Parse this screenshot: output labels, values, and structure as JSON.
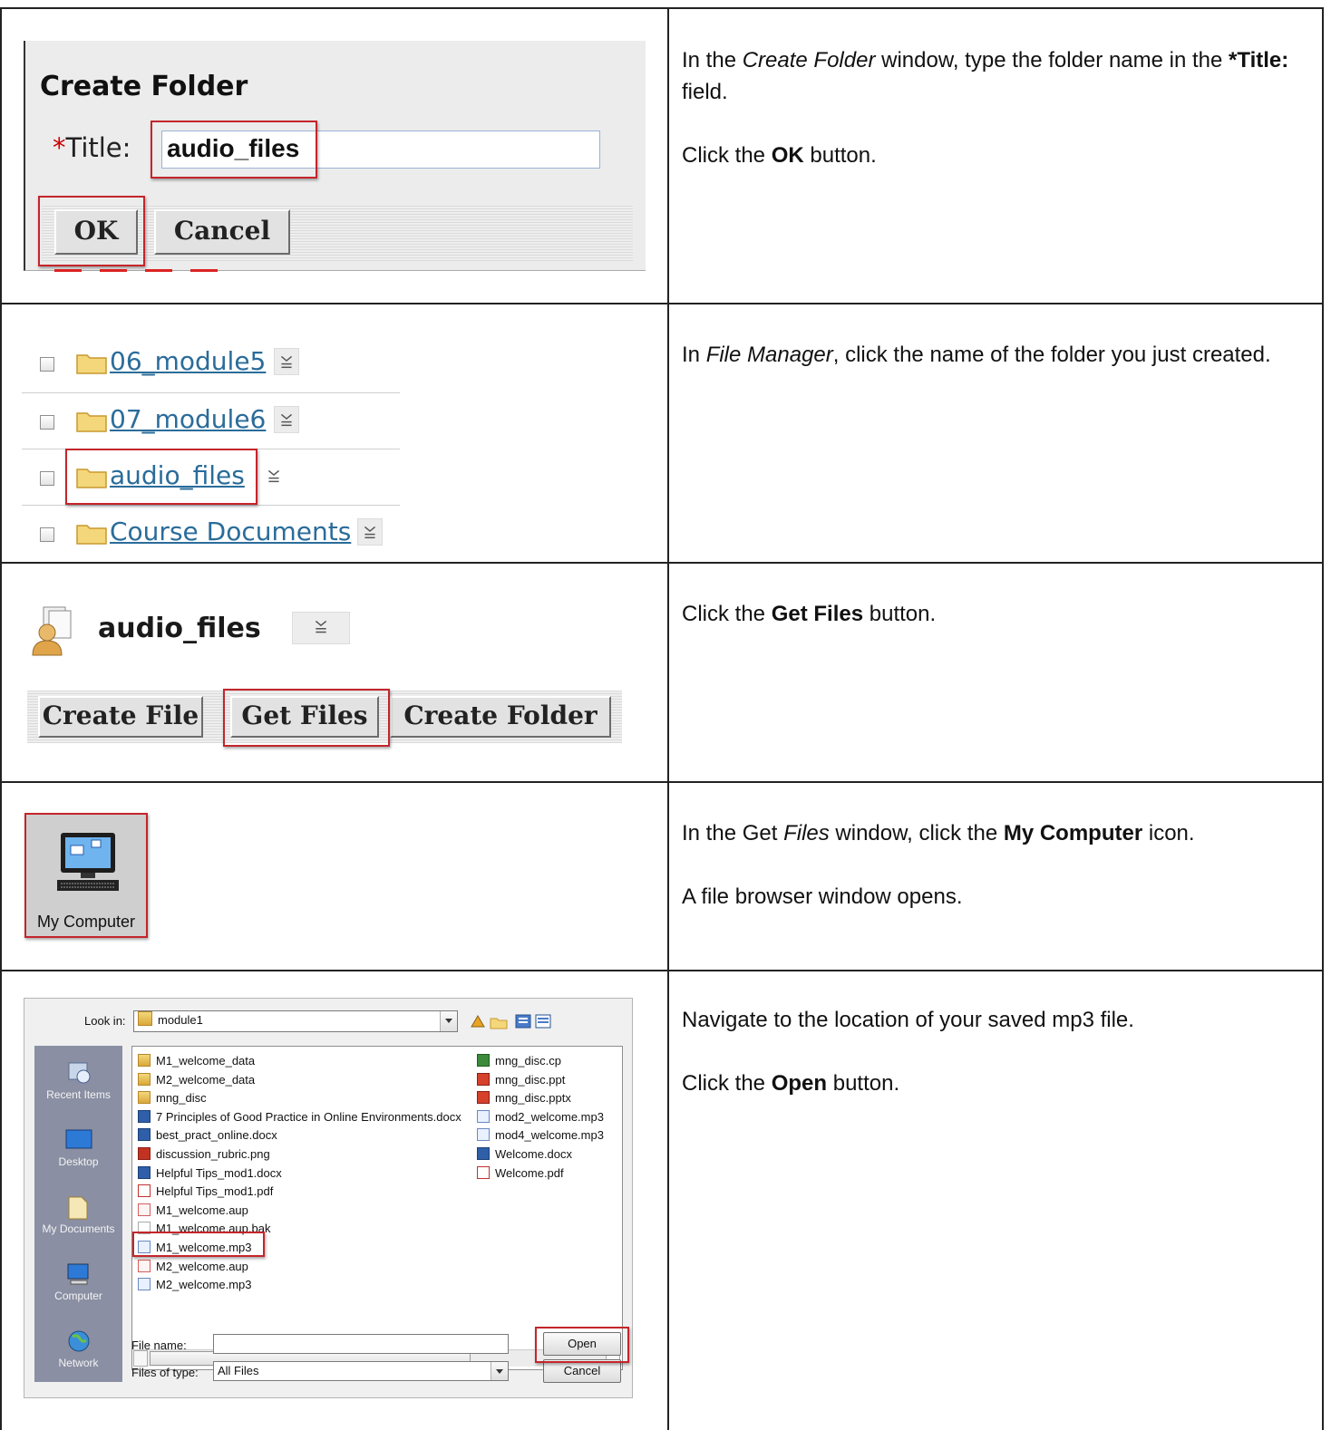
{
  "row1": {
    "dialog_title": "Create Folder",
    "title_required_mark": "*",
    "title_label": "Title:",
    "title_value": "audio_files",
    "ok_label": "OK",
    "cancel_label": "Cancel",
    "desc": {
      "p1_a": "In the ",
      "p1_em": "Create Folder",
      "p1_b": " window, type the folder name in the ",
      "p1_strong": "*Title:",
      "p1_c": " field.",
      "p2_a": "Click the ",
      "p2_strong": "OK",
      "p2_b": " button."
    }
  },
  "row2": {
    "folders": [
      {
        "name": "06_module5"
      },
      {
        "name": "07_module6"
      },
      {
        "name": "audio_files"
      },
      {
        "name": "Course Documents"
      }
    ],
    "desc": {
      "p1_a": "In ",
      "p1_em": "File Manager",
      "p1_b": ", click the name of the folder you just created."
    }
  },
  "row3": {
    "folder_title": "audio_files",
    "create_file_label": "Create File",
    "get_files_label": "Get Files",
    "create_folder_label": "Create Folder",
    "desc": {
      "p1_a": "Click the ",
      "p1_strong": "Get Files",
      "p1_b": " button."
    }
  },
  "row4": {
    "my_computer_label": "My Computer",
    "desc": {
      "p1_a": "In the Get ",
      "p1_em": "Files",
      "p1_b": " window, click the ",
      "p1_strong": "My Computer",
      "p1_c": " icon.",
      "p2": "A file browser window opens."
    }
  },
  "row5": {
    "look_in_label": "Look in:",
    "look_in_value": "module1",
    "sidebar": [
      "Recent Items",
      "Desktop",
      "My Documents",
      "Computer",
      "Network"
    ],
    "files_col1": [
      {
        "name": "M1_welcome_data",
        "icon": "folder"
      },
      {
        "name": "M2_welcome_data",
        "icon": "folder"
      },
      {
        "name": "mng_disc",
        "icon": "folder"
      },
      {
        "name": "7 Principles of Good Practice in Online Environments.docx",
        "icon": "docx"
      },
      {
        "name": "best_pract_online.docx",
        "icon": "docx"
      },
      {
        "name": "discussion_rubric.png",
        "icon": "png"
      },
      {
        "name": "Helpful Tips_mod1.docx",
        "icon": "docx"
      },
      {
        "name": "Helpful Tips_mod1.pdf",
        "icon": "pdf"
      },
      {
        "name": "M1_welcome.aup",
        "icon": "aup"
      },
      {
        "name": "M1_welcome.aup.bak",
        "icon": "blank"
      },
      {
        "name": "M1_welcome.mp3",
        "icon": "mp3"
      },
      {
        "name": "M2_welcome.aup",
        "icon": "aup"
      },
      {
        "name": "M2_welcome.mp3",
        "icon": "mp3"
      }
    ],
    "files_col2": [
      {
        "name": "mng_disc.cp",
        "icon": "cp"
      },
      {
        "name": "mng_disc.ppt",
        "icon": "ppt"
      },
      {
        "name": "mng_disc.pptx",
        "icon": "ppt"
      },
      {
        "name": "mod2_welcome.mp3",
        "icon": "mp3"
      },
      {
        "name": "mod4_welcome.mp3",
        "icon": "mp3"
      },
      {
        "name": "Welcome.docx",
        "icon": "docx"
      },
      {
        "name": "Welcome.pdf",
        "icon": "pdf"
      }
    ],
    "file_name_label": "File name:",
    "file_name_value": "",
    "files_of_type_label": "Files of type:",
    "files_of_type_value": "All Files",
    "open_label": "Open",
    "cancel_label": "Cancel",
    "desc": {
      "p1": "Navigate to the location of your saved mp3 file.",
      "p2_a": "Click the ",
      "p2_strong": "Open",
      "p2_b": " button."
    }
  },
  "colors": {
    "highlight": "#c4252b",
    "link": "#2a6c9a",
    "required": "#cc0000"
  }
}
